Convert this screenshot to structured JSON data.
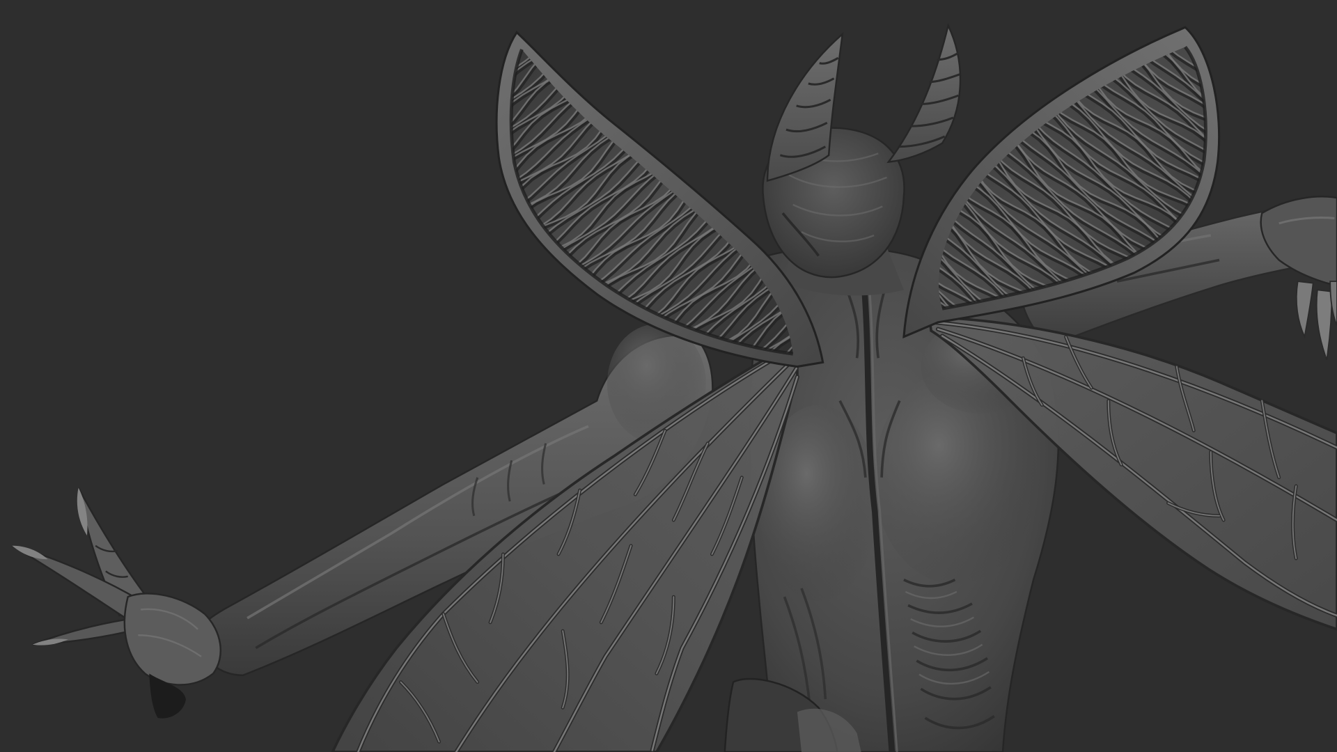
{
  "colors": {
    "background": "#2e2e2e",
    "material": "#5a5a5a",
    "ridge_highlight": "#7a7a7a",
    "ridge_shadow": "#242424"
  }
}
